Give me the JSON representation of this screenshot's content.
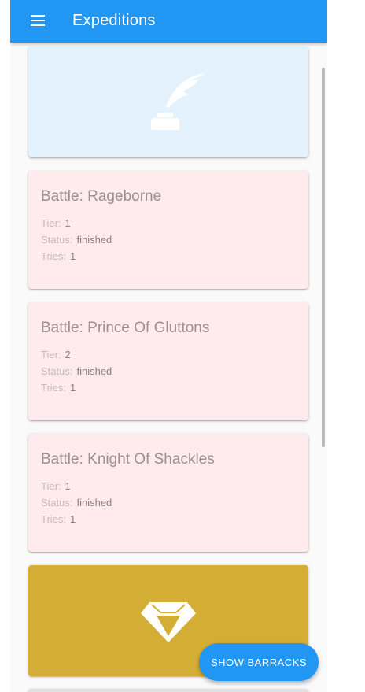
{
  "appbar": {
    "title": "Expeditions",
    "menu_icon": "hamburger-menu-icon"
  },
  "cards": [
    {
      "type": "image",
      "icon": "quill-inkwell-icon",
      "background": "#e3f2fd"
    },
    {
      "type": "battle",
      "title": "Battle: Rageborne",
      "tier_label": "Tier:",
      "tier": "1",
      "status_label": "Status:",
      "status": "finished",
      "tries_label": "Tries:",
      "tries": "1",
      "background": "#ffebee"
    },
    {
      "type": "battle",
      "title": "Battle: Prince Of Gluttons",
      "tier_label": "Tier:",
      "tier": "2",
      "status_label": "Status:",
      "status": "finished",
      "tries_label": "Tries:",
      "tries": "1",
      "background": "#ffebee"
    },
    {
      "type": "battle",
      "title": "Battle: Knight Of Shackles",
      "tier_label": "Tier:",
      "tier": "1",
      "status_label": "Status:",
      "status": "finished",
      "tries_label": "Tries:",
      "tries": "1",
      "background": "#ffebee"
    },
    {
      "type": "image",
      "icon": "diamond-icon",
      "background": "#d4ae34"
    }
  ],
  "fab": {
    "label": "SHOW BARRACKS"
  },
  "colors": {
    "primary": "#2196f3",
    "battle_card": "#ffebee",
    "quill_card": "#e3f2fd",
    "gem_card": "#d4ae34"
  }
}
